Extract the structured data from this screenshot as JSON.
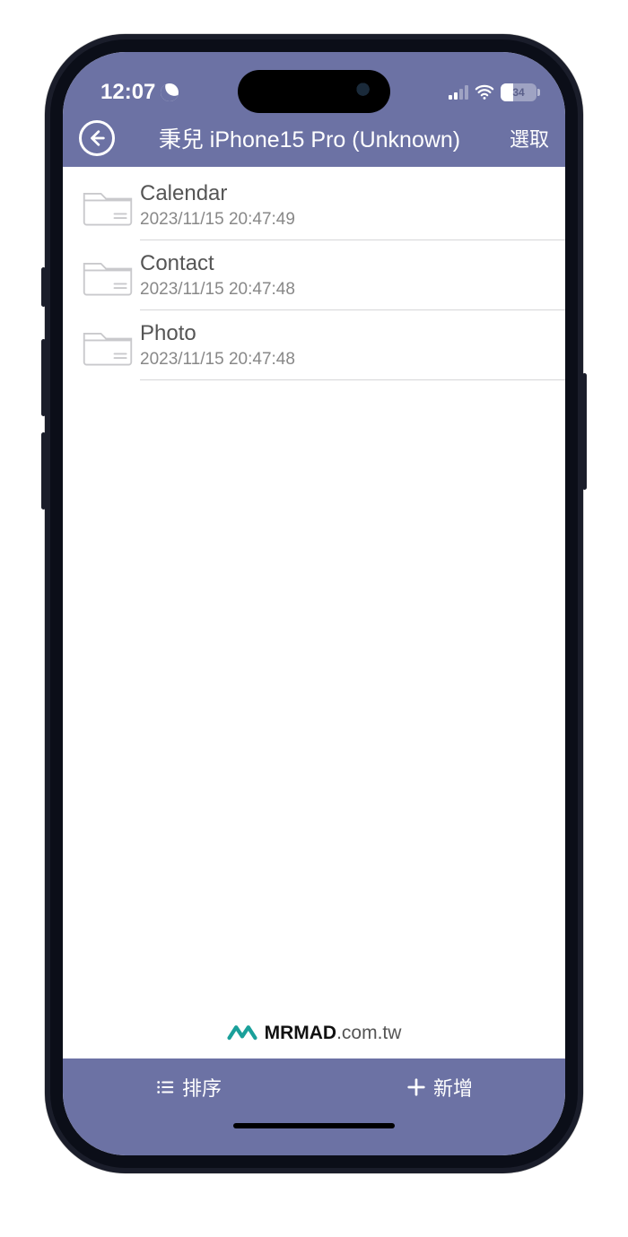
{
  "status": {
    "time": "12:07",
    "battery_pct": "34"
  },
  "nav": {
    "title": "秉兒 iPhone15 Pro (Unknown)",
    "select_label": "選取"
  },
  "folders": [
    {
      "name": "Calendar",
      "timestamp": "2023/11/15 20:47:49"
    },
    {
      "name": "Contact",
      "timestamp": "2023/11/15 20:47:48"
    },
    {
      "name": "Photo",
      "timestamp": "2023/11/15 20:47:48"
    }
  ],
  "watermark": {
    "brand": "MRMAD",
    "domain": ".com.tw"
  },
  "bottom": {
    "sort_label": "排序",
    "add_label": "新增"
  }
}
